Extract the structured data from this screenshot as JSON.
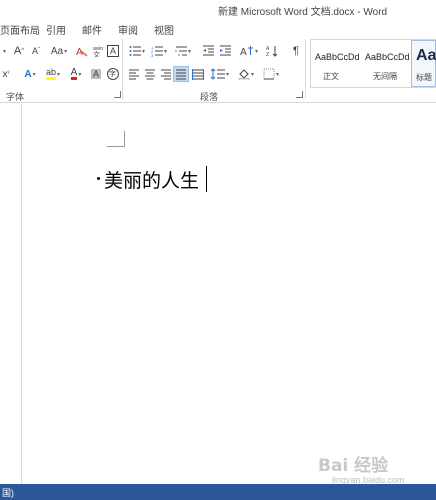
{
  "window": {
    "title": "新建 Microsoft Word 文档.docx - Word"
  },
  "ribbon_tabs": [
    {
      "label": "页面布局"
    },
    {
      "label": "引用"
    },
    {
      "label": "邮件"
    },
    {
      "label": "审阅"
    },
    {
      "label": "视图"
    }
  ],
  "font_group": {
    "label": "字体",
    "grow_font": "A",
    "shrink_font": "A",
    "change_case": "Aa",
    "char_border": "A",
    "superscript": "x",
    "text_effects": "A",
    "highlight": "ab",
    "font_color": "A",
    "char_shading": "A",
    "enclose_char": "字"
  },
  "paragraph_group": {
    "label": "段落"
  },
  "styles_gallery": {
    "items": [
      {
        "sample": "AaBbCcDd",
        "name": "正文"
      },
      {
        "sample": "AaBbCcDd",
        "name": "无间隔"
      },
      {
        "sample": "Aa",
        "name": "标题"
      }
    ]
  },
  "document": {
    "text": "美丽的人生"
  },
  "watermark": {
    "logo": "Bai 经验",
    "url": "jingyan.baidu.com"
  },
  "statusbar": {
    "text": "国)"
  },
  "colors": {
    "accent": "#2b579a",
    "highlight_yellow": "#ffff00",
    "font_red": "#e02020",
    "selected_button": "#c5daf2"
  }
}
